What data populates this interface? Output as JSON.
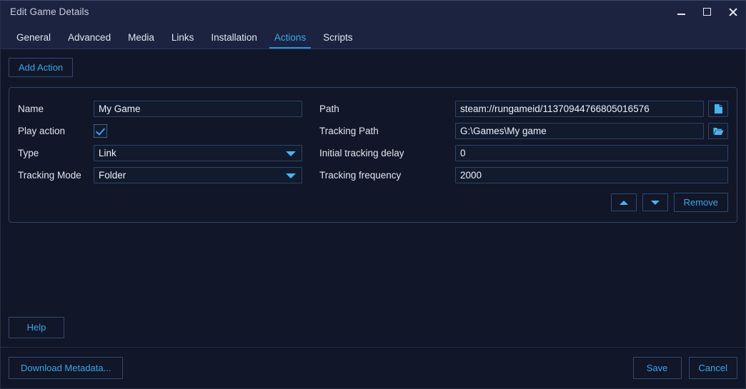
{
  "window": {
    "title": "Edit Game Details",
    "controls": {
      "minimize": "minimize-icon",
      "maximize": "maximize-icon",
      "close": "close-icon"
    }
  },
  "tabs": [
    {
      "label": "General",
      "active": false
    },
    {
      "label": "Advanced",
      "active": false
    },
    {
      "label": "Media",
      "active": false
    },
    {
      "label": "Links",
      "active": false
    },
    {
      "label": "Installation",
      "active": false
    },
    {
      "label": "Actions",
      "active": true
    },
    {
      "label": "Scripts",
      "active": false
    }
  ],
  "toolbar": {
    "add_action_label": "Add Action"
  },
  "action": {
    "left": {
      "name_label": "Name",
      "name_value": "My Game",
      "play_action_label": "Play action",
      "play_action_checked": true,
      "type_label": "Type",
      "type_value": "Link",
      "tracking_mode_label": "Tracking Mode",
      "tracking_mode_value": "Folder"
    },
    "right": {
      "path_label": "Path",
      "path_value": "steam://rungameid/11370944766805016576",
      "path_browse_icon": "file-icon",
      "tracking_path_label": "Tracking Path",
      "tracking_path_value": "G:\\Games\\My game",
      "tracking_path_browse_icon": "folder-icon",
      "initial_tracking_delay_label": "Initial tracking delay",
      "initial_tracking_delay_value": "0",
      "tracking_frequency_label": "Tracking frequency",
      "tracking_frequency_value": "2000"
    },
    "buttons": {
      "move_up_icon": "arrow-up-icon",
      "move_down_icon": "arrow-down-icon",
      "remove_label": "Remove"
    }
  },
  "footer": {
    "help_label": "Help",
    "download_metadata_label": "Download Metadata...",
    "save_label": "Save",
    "cancel_label": "Cancel"
  },
  "colors": {
    "accent": "#3ba7e8",
    "titlebar": "#1b2340",
    "background": "#111628",
    "border": "#2e4668",
    "field_border": "#2c4568"
  }
}
